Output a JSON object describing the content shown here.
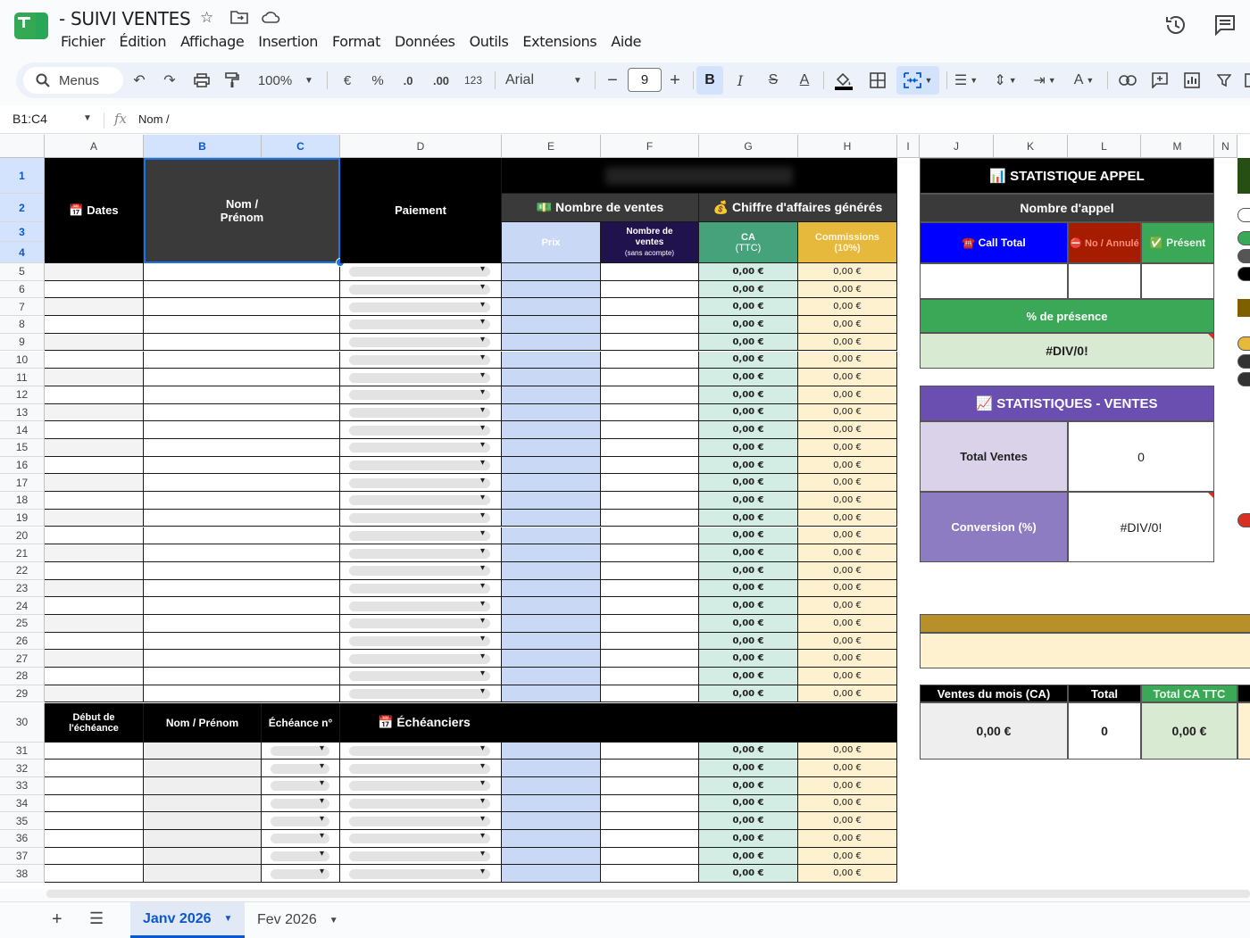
{
  "app": {
    "doc_title": "- SUIVI VENTES",
    "menu": [
      "Fichier",
      "Édition",
      "Affichage",
      "Insertion",
      "Format",
      "Données",
      "Outils",
      "Extensions",
      "Aide"
    ]
  },
  "toolbar": {
    "menus_label": "Menus",
    "zoom": "100%",
    "currency": "€",
    "percent": "%",
    "dec_less": ".0",
    "dec_more": ".00",
    "num_format": "123",
    "font": "Arial",
    "font_size": "9",
    "minus": "−",
    "plus": "+",
    "bold": "B",
    "italic": "I",
    "strike": "S",
    "text_color": "A"
  },
  "formula_bar": {
    "name_box": "B1:C4",
    "fx": "fx",
    "content": "Nom /"
  },
  "columns": [
    "A",
    "B",
    "C",
    "D",
    "E",
    "F",
    "G",
    "H",
    "I",
    "J",
    "K",
    "L",
    "M",
    "N"
  ],
  "rows": [
    "1",
    "2",
    "3",
    "4",
    "5",
    "6",
    "7",
    "8",
    "9",
    "10",
    "11",
    "12",
    "13",
    "14",
    "15",
    "16",
    "17",
    "18",
    "19",
    "20",
    "21",
    "22",
    "23",
    "24",
    "25",
    "26",
    "27",
    "28",
    "29",
    "30",
    "31",
    "32",
    "33",
    "34",
    "35",
    "36",
    "37",
    "38"
  ],
  "main_table": {
    "dates": "📅 Dates",
    "nom_line1": "Nom /",
    "nom_line2": "Prénom",
    "paiement": "Paiement",
    "nombre_ventes": "💵 Nombre de ventes",
    "chiffre_affaires": "💰 Chiffre d'affaires générés",
    "prix": "Prix",
    "nb_ventes_line1": "Nombre de",
    "nb_ventes_line2": "ventes",
    "nb_ventes_line3": "(sans acompte)",
    "ca_line1": "CA",
    "ca_line2": "(TTC)",
    "commissions_line1": "Commissions",
    "commissions_line2": "(10%)",
    "zero_eur": "0,00 €"
  },
  "echeances": {
    "debut_line1": "Début de",
    "debut_line2": "l'échéance",
    "nom_prenom": "Nom / Prénom",
    "echeance_no": "Échéance n°",
    "echeanciers": "📅 Échéanciers"
  },
  "side_panel": {
    "stat_appel_title": "📊 STATISTIQUE APPEL",
    "nombre_appel": "Nombre d'appel",
    "call_total": "☎️ Call Total",
    "no_annule": "⛔ No / Annulé",
    "present": "✅ Présent",
    "pct_presence": "% de présence",
    "pct_presence_value": "#DIV/0!",
    "stat_ventes_title": "📈 STATISTIQUES - VENTES",
    "total_ventes": "Total Ventes",
    "total_ventes_value": "0",
    "conversion": "Conversion (%)",
    "conversion_value": "#DIV/0!",
    "ventes_mois": "Ventes du mois (CA)",
    "total": "Total",
    "total_ca_ttc": "Total CA TTC",
    "ventes_mois_value": "0,00 €",
    "total_value": "0",
    "total_ca_ttc_value": "0,00 €"
  },
  "sheets": {
    "tabs": [
      "Janv 2026",
      "Fev 2026"
    ],
    "active": "Janv 2026"
  },
  "colors": {
    "black": "#000000",
    "dark_grey": "#3a3a3a",
    "header_blue": "#0000ff",
    "header_red": "#a61c00",
    "green": "#3aa857",
    "purple": "#6a4fb0",
    "light_purple": "#8e7cc3",
    "gold": "#b8902a",
    "ca_green": "#45a27a",
    "commission_gold": "#e6b83c",
    "nb_ventes_purple": "#20124d"
  }
}
